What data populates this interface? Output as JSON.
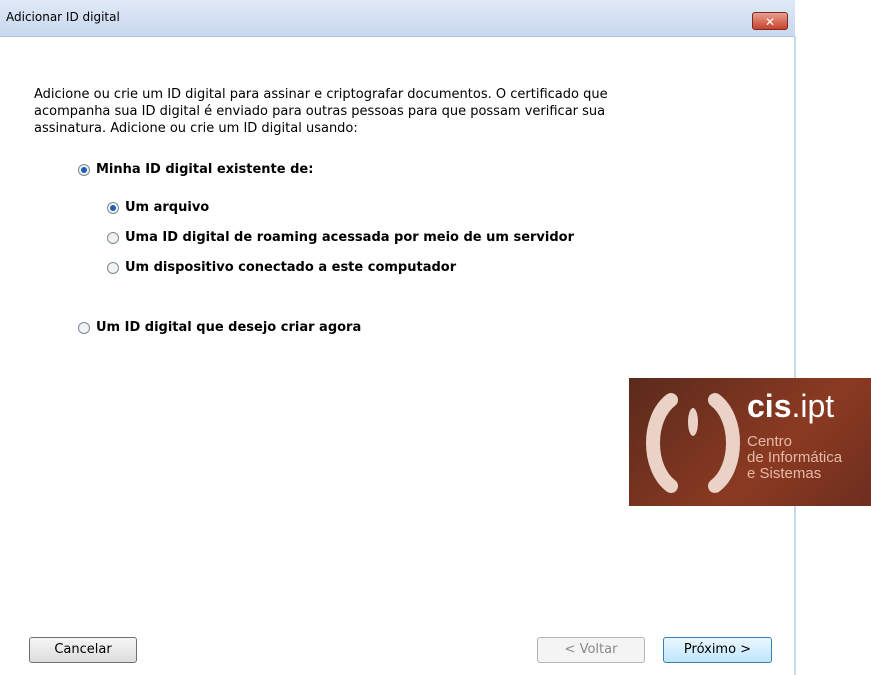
{
  "window": {
    "title": "Adicionar ID digital",
    "close_label": "✕"
  },
  "intro_text": "Adicione ou crie um ID digital para assinar e criptografar documentos. O certificado que acompanha sua ID digital é enviado para outras pessoas para que possam verificar sua assinatura. Adicione ou crie um ID digital usando:",
  "options": {
    "existing": {
      "label": "Minha ID digital existente de:",
      "checked": true
    },
    "file": {
      "label": "Um arquivo",
      "checked": true
    },
    "roaming": {
      "label": "Uma ID digital de roaming acessada por meio de um servidor",
      "checked": false
    },
    "device": {
      "label": "Um dispositivo conectado a este computador",
      "checked": false
    },
    "create": {
      "label": "Um ID digital que desejo criar agora",
      "checked": false
    }
  },
  "buttons": {
    "cancel": "Cancelar",
    "back": "< Voltar",
    "next": "Próximo >"
  },
  "logo": {
    "brand_bold": "cis",
    "brand_rest": ".ipt",
    "line1": "Centro",
    "line2": "de Informática",
    "line3": "e Sistemas"
  }
}
